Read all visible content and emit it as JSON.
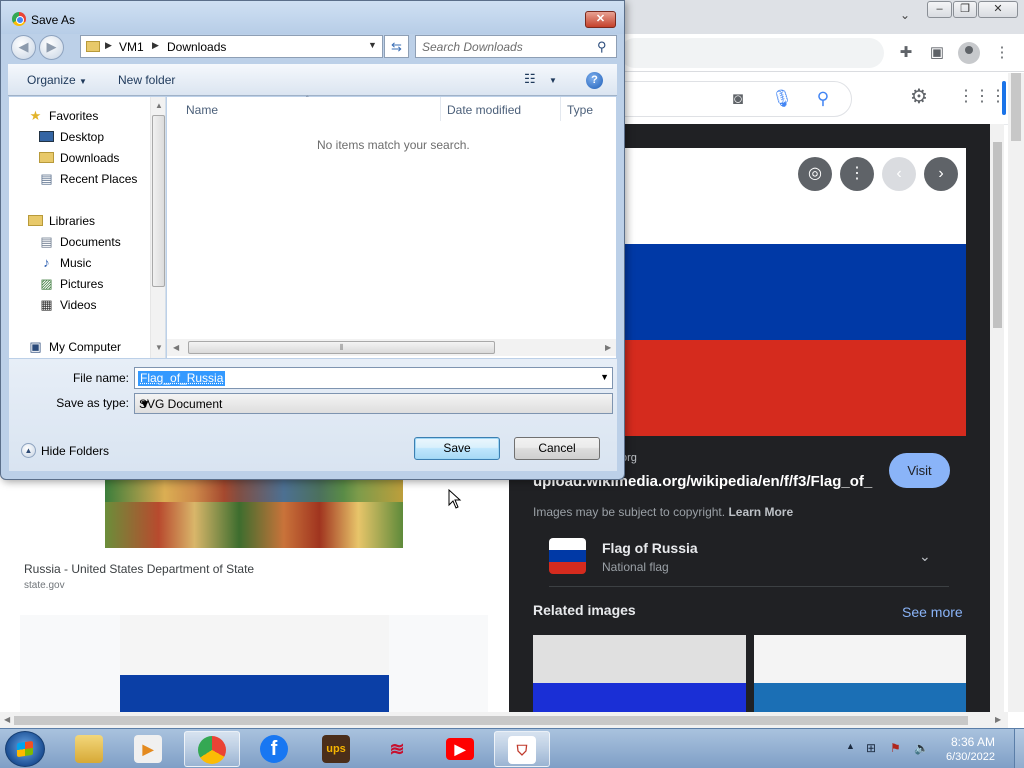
{
  "dialog": {
    "title": "Save As",
    "breadcrumb": [
      "VM1",
      "Downloads"
    ],
    "search_placeholder": "Search Downloads",
    "toolbar": {
      "organize": "Organize",
      "new_folder": "New folder"
    },
    "nav_pane": {
      "favorites_label": "Favorites",
      "favorites": [
        "Desktop",
        "Downloads",
        "Recent Places"
      ],
      "libraries_label": "Libraries",
      "libraries": [
        "Documents",
        "Music",
        "Pictures",
        "Videos"
      ],
      "computer_label": "My Computer"
    },
    "columns": [
      "Name",
      "Date modified",
      "Type"
    ],
    "empty_message": "No items match your search.",
    "file_name_label": "File name:",
    "file_name_value": "Flag_of_Russia",
    "save_as_type_label": "Save as type:",
    "save_as_type_value": "SVG Document",
    "hide_folders": "Hide Folders",
    "save_button": "Save",
    "cancel_button": "Cancel"
  },
  "browser": {
    "result": {
      "title": "Russia - United States Department of State",
      "site": "state.gov"
    },
    "preview": {
      "site_fragment": "org",
      "url": "upload.wikimedia.org/wikipedia/en/f/f3/Flag_of_...",
      "visit": "Visit",
      "copyright_text": "Images may be subject to copyright.",
      "learn_more": "Learn More",
      "entity_title": "Flag of Russia",
      "entity_subtitle": "National flag",
      "related_title": "Related images",
      "see_more": "See more"
    }
  },
  "taskbar": {
    "time": "8:36 AM",
    "date": "6/30/2022",
    "apps": [
      "file-explorer",
      "media-player",
      "chrome",
      "facebook",
      "ups",
      "bank-of-america",
      "youtube",
      "app-shortcut"
    ]
  },
  "colors": {
    "flag_white": "#ffffff",
    "flag_blue": "#0039a6",
    "flag_red": "#d52b1e",
    "selection": "#3399ff"
  }
}
